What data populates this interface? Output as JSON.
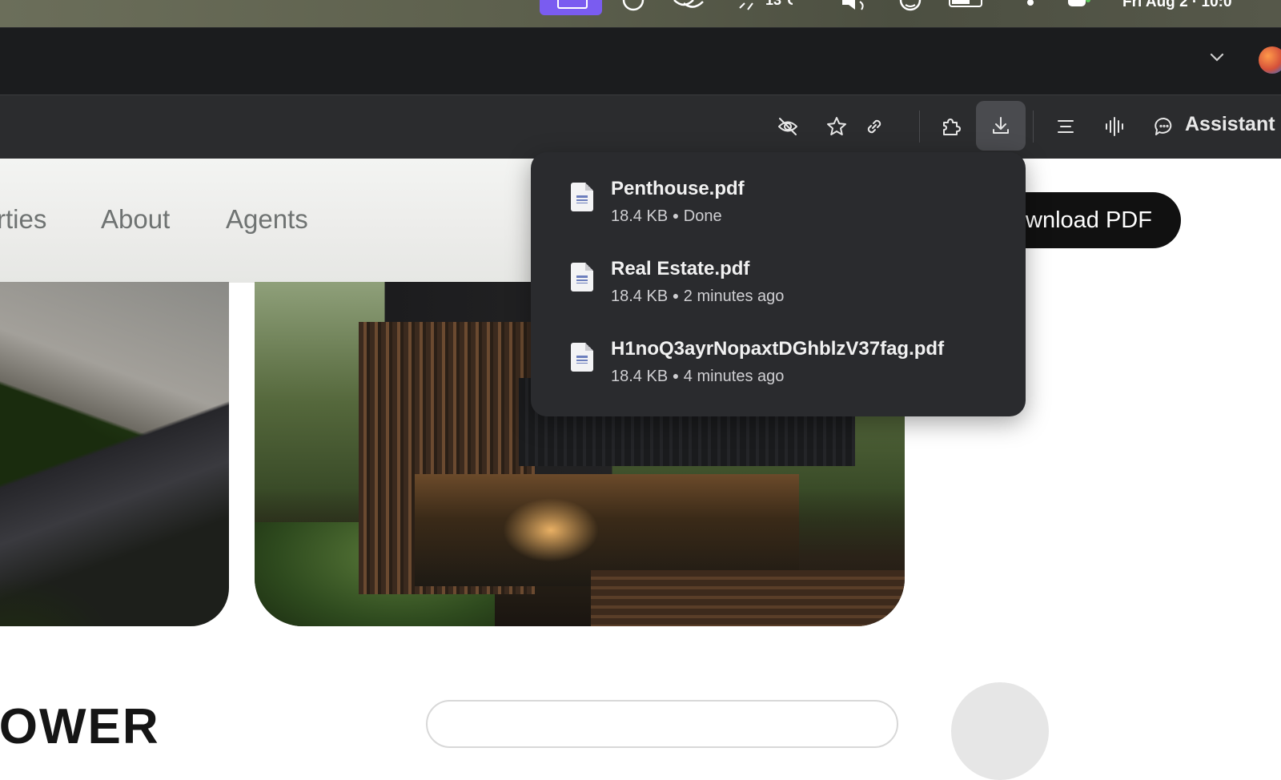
{
  "menubar": {
    "clock": "Fri Aug 2 · 10:0",
    "app_color": "#7a5cf0"
  },
  "toolbar": {
    "assistant_label": "Assistant",
    "icons": [
      "eye-off-icon",
      "star-icon",
      "link-icon",
      "extensions-icon",
      "download-icon",
      "reader-icon",
      "audio-icon",
      "chat-icon"
    ]
  },
  "website": {
    "nav": {
      "properties": "rties",
      "about": "About",
      "agents": "Agents"
    },
    "download_pdf_label": "wnload PDF",
    "heading_partial": "TOWER"
  },
  "downloads": {
    "items": [
      {
        "name": "Penthouse.pdf",
        "size": "18.4 KB",
        "status": "Done"
      },
      {
        "name": "Real Estate.pdf",
        "size": "18.4 KB",
        "status": "2 minutes ago"
      },
      {
        "name": "H1noQ3ayrNopaxtDGhblzV37fag.pdf",
        "size": "18.4 KB",
        "status": "4 minutes ago"
      }
    ],
    "separator": "●"
  }
}
